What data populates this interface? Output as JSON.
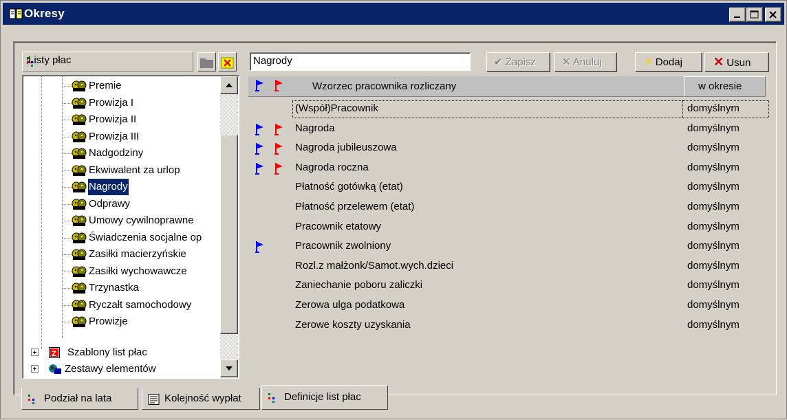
{
  "window": {
    "title": "Okresy"
  },
  "tree": {
    "header": "Listy płac",
    "items": [
      {
        "label": "Premie"
      },
      {
        "label": "Prowizja I"
      },
      {
        "label": "Prowizja II"
      },
      {
        "label": "Prowizja III"
      },
      {
        "label": "Nadgodziny"
      },
      {
        "label": "Ekwiwalent za urlop"
      },
      {
        "label": "Nagrody",
        "selected": true
      },
      {
        "label": "Odprawy"
      },
      {
        "label": "Umowy cywilnoprawne"
      },
      {
        "label": "Świadczenia socjalne op"
      },
      {
        "label": "Zasiłki macierzyńskie"
      },
      {
        "label": "Zasiłki wychowawcze"
      },
      {
        "label": "Trzynastka"
      },
      {
        "label": "Ryczałt samochodowy"
      },
      {
        "label": "Prowizje"
      }
    ],
    "roots": [
      {
        "label": "Szablony list płac"
      },
      {
        "label": "Zestawy elementów"
      }
    ]
  },
  "editor": {
    "name_value": "Nagrody",
    "save_label": "Zapisz",
    "cancel_label": "Anuluj",
    "add_label": "Dodaj",
    "delete_label": "Usun"
  },
  "grid": {
    "col_pattern": "Wzorzec pracownika rozliczany",
    "col_period": "w okresie",
    "rows": [
      {
        "name": "(Współ)Pracownik",
        "period": "domyślnym",
        "blue": false,
        "red": false
      },
      {
        "name": "Nagroda",
        "period": "domyślnym",
        "blue": true,
        "red": true
      },
      {
        "name": "Nagroda jubileuszowa",
        "period": "domyślnym",
        "blue": true,
        "red": true
      },
      {
        "name": "Nagroda roczna",
        "period": "domyślnym",
        "blue": true,
        "red": true
      },
      {
        "name": "Płatność gotówką (etat)",
        "period": "domyślnym",
        "blue": false,
        "red": false
      },
      {
        "name": "Płatność przelewem (etat)",
        "period": "domyślnym",
        "blue": false,
        "red": false
      },
      {
        "name": "Pracownik etatowy",
        "period": "domyślnym",
        "blue": false,
        "red": false
      },
      {
        "name": "Pracownik zwolniony",
        "period": "domyślnym",
        "blue": true,
        "red": false
      },
      {
        "name": "Rozl.z małżonk/Samot.wych.dzieci",
        "period": "domyślnym",
        "blue": false,
        "red": false
      },
      {
        "name": "Zaniechanie poboru zaliczki",
        "period": "domyślnym",
        "blue": false,
        "red": false
      },
      {
        "name": "Zerowa ulga podatkowa",
        "period": "domyślnym",
        "blue": false,
        "red": false
      },
      {
        "name": "Zerowe koszty uzyskania",
        "period": "domyślnym",
        "blue": false,
        "red": false
      }
    ]
  },
  "tabs": [
    {
      "label": "Podział na lata"
    },
    {
      "label": "Kolejność wypłat"
    },
    {
      "label": "Definicje list płac"
    }
  ],
  "colors": {
    "title_bar": "#0a246a",
    "face": "#d4d0c8",
    "flag_blue": "#0000ff",
    "flag_red": "#ff0000"
  }
}
